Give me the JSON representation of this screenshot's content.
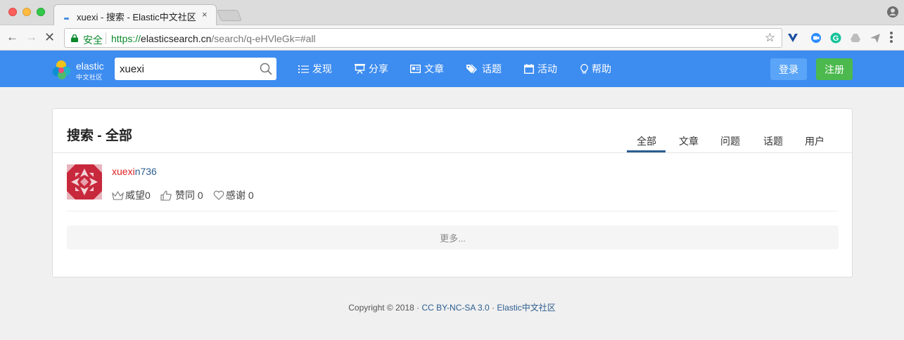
{
  "browser": {
    "tab_title": "xuexi - 搜索 - Elastic中文社区",
    "tab_close": "×",
    "secure_label": "安全",
    "url_protocol": "https://",
    "url_host": "elasticsearch.cn",
    "url_path": "/search/q-eHVleGk=#all",
    "icons": [
      "back-icon",
      "forward-icon",
      "stop-icon",
      "lock-icon",
      "star-icon",
      "profile-icon",
      "menu-icon"
    ],
    "accent_secure": "#0a8a2c"
  },
  "header": {
    "logo_line1": "elastic",
    "logo_line2": "中文社区",
    "search_value": "xuexi",
    "nav": [
      {
        "label": "发现",
        "icon": "list-icon"
      },
      {
        "label": "分享",
        "icon": "presentation-icon"
      },
      {
        "label": "文章",
        "icon": "article-icon"
      },
      {
        "label": "话题",
        "icon": "tags-icon"
      },
      {
        "label": "活动",
        "icon": "calendar-icon"
      },
      {
        "label": "帮助",
        "icon": "lightbulb-icon"
      }
    ],
    "login_label": "登录",
    "register_label": "注册",
    "bg_color": "#3d8cf0"
  },
  "main": {
    "title": "搜索 - 全部",
    "tabs": [
      {
        "label": "全部",
        "active": true
      },
      {
        "label": "文章",
        "active": false
      },
      {
        "label": "问题",
        "active": false
      },
      {
        "label": "话题",
        "active": false
      },
      {
        "label": "用户",
        "active": false
      }
    ],
    "result": {
      "name_highlight": "xuexi",
      "name_rest": "n736",
      "reputation_label": "威望",
      "reputation_value": "0",
      "agree_label": "赞同",
      "agree_value": "0",
      "thanks_label": "感谢",
      "thanks_value": "0"
    },
    "more_label": "更多..."
  },
  "footer": {
    "copyright": "Copyright © 2018 · ",
    "license": "CC BY-NC-SA 3.0",
    "separator": " · ",
    "site": "Elastic中文社区"
  }
}
